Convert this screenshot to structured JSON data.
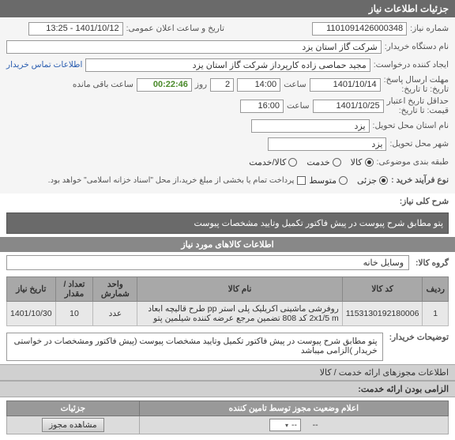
{
  "header": {
    "title": "جزئیات اطلاعات نیاز"
  },
  "form": {
    "number_label": "شماره نیاز:",
    "number": "1101091426000348",
    "public_time_label": "تاریخ و ساعت اعلان عمومی:",
    "public_time": "1401/10/12 - 13:25",
    "buyer_label": "نام دستگاه خریدار:",
    "buyer": "شرکت گاز استان یزد",
    "creator_label": "ایجاد کننده درخواست:",
    "creator": "مجید حماصی زاده کارپرداز شرکت گاز استان یزد",
    "contact_link": "اطلاعات تماس خریدار",
    "deadline_label": "مهلت ارسال پاسخ:",
    "till_label": "تاریخ: تا تاریخ:",
    "deadline_date": "1401/10/14",
    "saat": "ساعت",
    "deadline_time": "14:00",
    "remain_days": "2",
    "remain_time": "00:22:46",
    "remain_suffix": "ساعت باقی مانده",
    "credit_label": "حداقل تاریخ اعتبار",
    "credit_till": "قیمت: تا تاریخ:",
    "credit_date": "1401/10/25",
    "credit_time": "16:00",
    "city_req_label": "نام استان محل تحویل:",
    "city_req": "یزد",
    "city_deliver_label": "شهر محل تحویل:",
    "city_deliver": "یزد",
    "category_label": "طبقه بندی موضوعی:",
    "cat_kala": "کالا",
    "cat_khadamat": "خدمت",
    "cat_kalakhad": "کالا/خدمت",
    "process_label": "نوع فرآیند خرید :",
    "proc_partial": "جزئی",
    "proc_mid": "متوسط",
    "proc_note": "پرداخت تمام یا بخشی از مبلغ خرید،از محل \"اسناد خزانه اسلامی\" خواهد بود."
  },
  "need": {
    "label": "شرح کلی نیاز:",
    "text": "پتو مطابق شرح پیوست در پیش فاکتور تکمیل وتایید مشخصات پیوست"
  },
  "goods": {
    "section_title": "اطلاعات کالاهای مورد نیاز",
    "group_label": "گروه کالا:",
    "group": "وسایل خانه"
  },
  "table": {
    "col_row": "ردیف",
    "col_code": "کد کالا",
    "col_name": "نام کالا",
    "col_unit": "واحد شمارش",
    "col_qty": "تعداد / مقدار",
    "col_date": "تاریخ نیاز",
    "rows": [
      {
        "idx": "1",
        "code": "1153130192180006",
        "name": "روفرشی ماشینی اکریلیک پلی استر pp طرح قالیچه ابعاد 2x1/5 m کد 808 تضمین مرجع عرضه کننده شیلمین پتو",
        "unit": "عدد",
        "qty": "10",
        "date": "1401/10/30"
      }
    ]
  },
  "buyer_note": {
    "label": "توضیحات خریدار:",
    "text": "پتو مطابق شرح پیوست در پیش فاکتور تکمیل وتایید مشخصات پیوست (پیش فاکتور ومشخصات در خواستی خریدار )الزامی میباشد"
  },
  "permits": {
    "section": "اطلاعات مجوزهای ارائه خدمت / کالا",
    "mandatory_label": "الزامی بودن ارائه خدمت:",
    "col_status": "اعلام وضعیت مجوز توسط تامین کننده",
    "col_detail": "جزئیات",
    "dash": "--",
    "view_btn": "مشاهده مجوز"
  }
}
